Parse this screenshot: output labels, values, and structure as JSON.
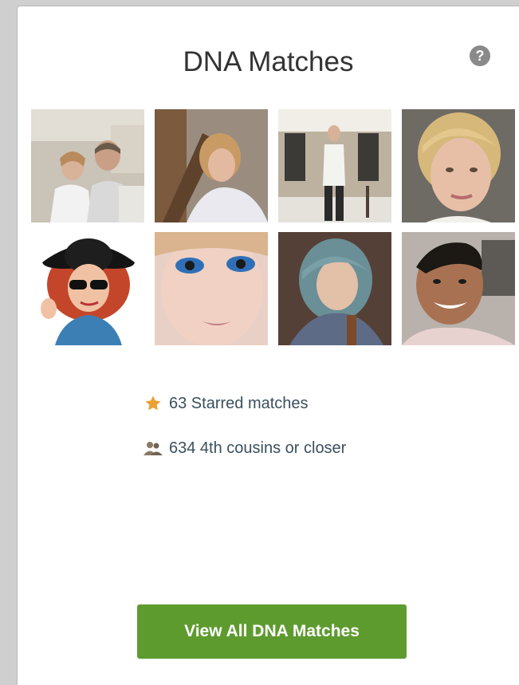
{
  "widget": {
    "title": "DNA Matches",
    "help_icon": "question-circle-icon",
    "help_glyph": "?",
    "matches": [
      {
        "id": "match-1",
        "icon": "couple-photo"
      },
      {
        "id": "match-2",
        "icon": "woman-blonde-photo"
      },
      {
        "id": "match-3",
        "icon": "man-standing-photo"
      },
      {
        "id": "match-4",
        "icon": "woman-closeup-photo"
      },
      {
        "id": "match-5",
        "icon": "cartoon-avatar-photo"
      },
      {
        "id": "match-6",
        "icon": "woman-makeup-photo"
      },
      {
        "id": "match-7",
        "icon": "woman-teal-hair-photo"
      },
      {
        "id": "match-8",
        "icon": "man-smiling-photo"
      }
    ],
    "stats": {
      "starred": "63 Starred matches",
      "starred_icon": "star-icon",
      "cousins": "634 4th cousins or closer",
      "cousins_icon": "people-icon"
    },
    "button_label": "View All DNA Matches"
  },
  "colors": {
    "button_green": "#5e9b2f",
    "star_gold": "#e9a133",
    "text_slate": "#3b4f5e"
  }
}
